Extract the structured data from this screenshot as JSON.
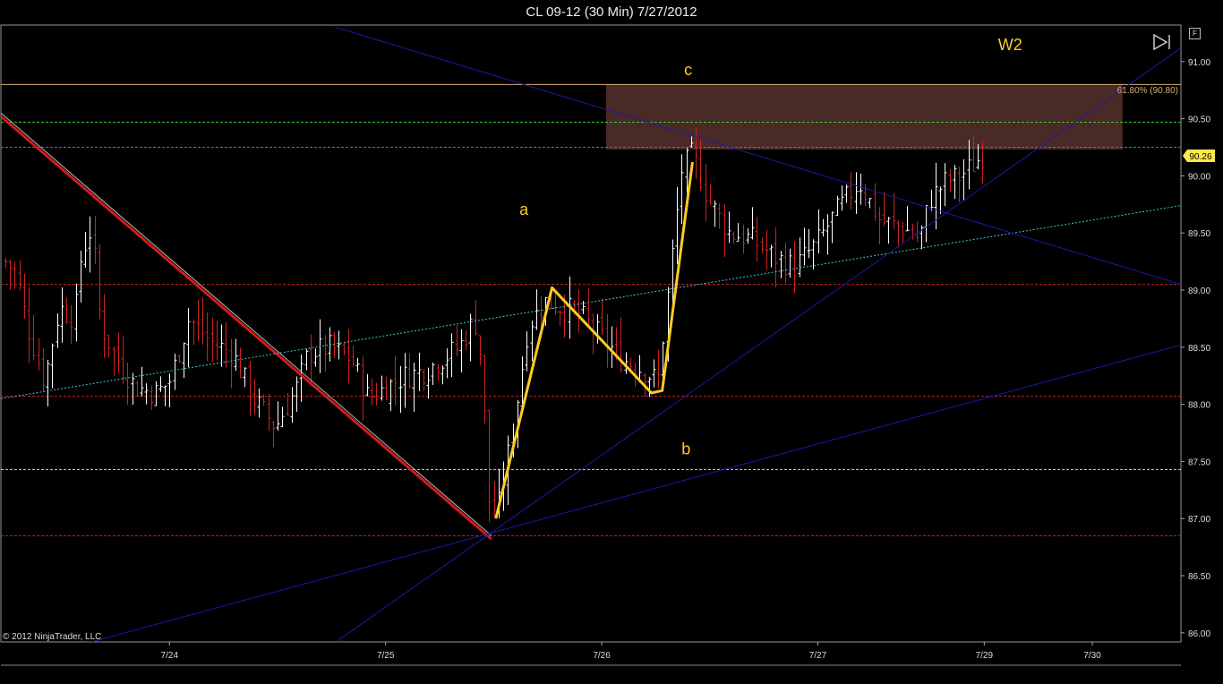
{
  "title": "CL 09-12 (30 Min)  7/27/2012",
  "copyright": "© 2012 NinjaTrader, LLC",
  "f_button": "F",
  "icons": {
    "play": "play-end-icon"
  },
  "colors": {
    "background": "#000000",
    "up_bar": "#ffffff",
    "down_bar": "#cc2222",
    "trendline_blue": "#1a1aaa",
    "trendline_red": "#d41a1a",
    "wave": "#ffcc22",
    "fib": "#d8b070",
    "zone": "#4a2a26",
    "cyan": "#49c4d6"
  },
  "chart_data": {
    "type": "ohlc",
    "title": "CL 09-12 (30 Min)  7/27/2012",
    "ylim": [
      85.92,
      91.32
    ],
    "y_ticks": [
      "86.00",
      "86.50",
      "87.00",
      "87.50",
      "88.00",
      "88.50",
      "89.00",
      "89.50",
      "90.00",
      "90.50",
      "91.00"
    ],
    "x_ticks": [
      {
        "label": "7/24",
        "x": 0.46
      },
      {
        "label": "7/25",
        "x": 1.46
      },
      {
        "label": "7/26",
        "x": 2.46
      },
      {
        "label": "7/27",
        "x": 3.46
      },
      {
        "label": "7/29",
        "x": 4.23
      },
      {
        "label": "7/30",
        "x": 4.73
      }
    ],
    "xlim": [
      -0.32,
      5.14
    ],
    "last_price": "90.26",
    "fib_label": "61.80% (90.80)",
    "horizontal_lines": [
      {
        "y": 90.8,
        "color": "#d8b070",
        "style": "solid"
      },
      {
        "y": 90.47,
        "color": "#3ec43e",
        "style": "dashed"
      },
      {
        "y": 90.25,
        "color": "#5a6ad8",
        "style": "dashed"
      },
      {
        "y": 89.05,
        "color": "#cc2222",
        "style": "dashed"
      },
      {
        "y": 88.07,
        "color": "#cc2222",
        "style": "dashed"
      },
      {
        "y": 87.43,
        "color": "#e0d8a0",
        "style": "dashed"
      },
      {
        "y": 86.85,
        "color": "#cc2222",
        "style": "dashed"
      }
    ],
    "zone": {
      "x0": 2.48,
      "x1": 4.87,
      "y0": 90.23,
      "y1": 90.8
    },
    "trendlines": [
      {
        "x1": -0.32,
        "y1": 90.52,
        "x2": 1.95,
        "y2": 86.82,
        "color": "#d41a1a",
        "width": 3
      },
      {
        "x1": -0.32,
        "y1": 90.55,
        "x2": 1.95,
        "y2": 86.85,
        "color": "#bbbbbb",
        "width": 1
      },
      {
        "x1": -0.32,
        "y1": 88.05,
        "x2": 5.14,
        "y2": 89.74,
        "color": "#49c4d6",
        "width": 1,
        "dash": "2,2"
      },
      {
        "x1": 1.23,
        "y1": 91.3,
        "x2": 5.14,
        "y2": 89.05,
        "color": "#1a1aaa",
        "width": 1
      },
      {
        "x1": 1.23,
        "y1": 85.92,
        "x2": 5.14,
        "y2": 91.12,
        "color": "#1a1aaa",
        "width": 1
      },
      {
        "x1": 0.1,
        "y1": 85.92,
        "x2": 5.14,
        "y2": 88.52,
        "color": "#1a1aaa",
        "width": 1
      }
    ],
    "wave_path": [
      {
        "x": 1.97,
        "y": 87.0
      },
      {
        "x": 2.23,
        "y": 89.02
      },
      {
        "x": 2.69,
        "y": 88.1
      },
      {
        "x": 2.74,
        "y": 88.12
      },
      {
        "x": 2.88,
        "y": 90.12
      }
    ],
    "annotations": [
      {
        "text": "a",
        "x": 2.1,
        "y": 89.66
      },
      {
        "text": "b",
        "x": 2.85,
        "y": 87.56
      },
      {
        "text": "c",
        "x": 2.86,
        "y": 90.88
      },
      {
        "text": "W2",
        "x": 4.35,
        "y": 91.1
      }
    ],
    "anchors": [
      {
        "x": -0.3,
        "y": 89.25
      },
      {
        "x": -0.25,
        "y": 89.15
      },
      {
        "x": -0.2,
        "y": 88.7
      },
      {
        "x": -0.12,
        "y": 88.2
      },
      {
        "x": -0.05,
        "y": 88.85
      },
      {
        "x": 0.02,
        "y": 88.75
      },
      {
        "x": 0.05,
        "y": 89.3
      },
      {
        "x": 0.1,
        "y": 89.55
      },
      {
        "x": 0.14,
        "y": 88.7
      },
      {
        "x": 0.2,
        "y": 88.45
      },
      {
        "x": 0.3,
        "y": 88.15
      },
      {
        "x": 0.4,
        "y": 88.1
      },
      {
        "x": 0.46,
        "y": 88.2
      },
      {
        "x": 0.55,
        "y": 88.75
      },
      {
        "x": 0.65,
        "y": 88.55
      },
      {
        "x": 0.75,
        "y": 88.45
      },
      {
        "x": 0.85,
        "y": 88.05
      },
      {
        "x": 0.95,
        "y": 87.8
      },
      {
        "x": 1.05,
        "y": 88.15
      },
      {
        "x": 1.1,
        "y": 88.45
      },
      {
        "x": 1.2,
        "y": 88.5
      },
      {
        "x": 1.3,
        "y": 88.4
      },
      {
        "x": 1.38,
        "y": 88.05
      },
      {
        "x": 1.46,
        "y": 88.15
      },
      {
        "x": 1.55,
        "y": 88.25
      },
      {
        "x": 1.65,
        "y": 88.3
      },
      {
        "x": 1.72,
        "y": 88.4
      },
      {
        "x": 1.8,
        "y": 88.5
      },
      {
        "x": 1.87,
        "y": 88.75
      },
      {
        "x": 1.91,
        "y": 88.3
      },
      {
        "x": 1.93,
        "y": 87.2
      },
      {
        "x": 1.97,
        "y": 87.0
      },
      {
        "x": 2.05,
        "y": 87.8
      },
      {
        "x": 2.12,
        "y": 88.7
      },
      {
        "x": 2.2,
        "y": 88.9
      },
      {
        "x": 2.27,
        "y": 88.85
      },
      {
        "x": 2.35,
        "y": 88.8
      },
      {
        "x": 2.45,
        "y": 88.6
      },
      {
        "x": 2.55,
        "y": 88.4
      },
      {
        "x": 2.65,
        "y": 88.3
      },
      {
        "x": 2.72,
        "y": 88.2
      },
      {
        "x": 2.78,
        "y": 89.2
      },
      {
        "x": 2.83,
        "y": 90.05
      },
      {
        "x": 2.88,
        "y": 90.2
      },
      {
        "x": 2.95,
        "y": 89.8
      },
      {
        "x": 3.05,
        "y": 89.5
      },
      {
        "x": 3.15,
        "y": 89.45
      },
      {
        "x": 3.25,
        "y": 89.3
      },
      {
        "x": 3.35,
        "y": 89.2
      },
      {
        "x": 3.45,
        "y": 89.4
      },
      {
        "x": 3.55,
        "y": 89.7
      },
      {
        "x": 3.65,
        "y": 89.95
      },
      {
        "x": 3.75,
        "y": 89.6
      },
      {
        "x": 3.85,
        "y": 89.55
      },
      {
        "x": 3.93,
        "y": 89.45
      },
      {
        "x": 3.98,
        "y": 89.8
      },
      {
        "x": 4.05,
        "y": 89.95
      },
      {
        "x": 4.12,
        "y": 90.0
      },
      {
        "x": 4.18,
        "y": 90.1
      },
      {
        "x": 4.23,
        "y": 90.2
      }
    ]
  }
}
